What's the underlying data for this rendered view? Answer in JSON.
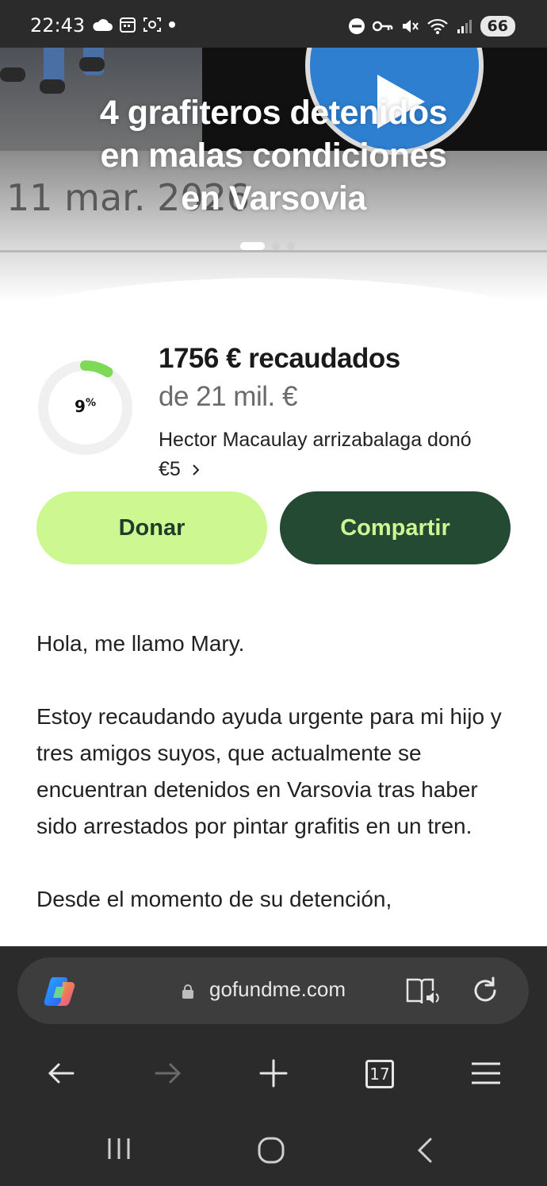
{
  "status_bar": {
    "time": "22:43",
    "battery": "66",
    "left_icons": [
      "cloud-icon",
      "calendar-icon",
      "screenshot-icon",
      "dot-icon"
    ],
    "right_icons": [
      "do-not-disturb-icon",
      "key-icon",
      "mute-icon",
      "wifi-icon",
      "signal-icon"
    ]
  },
  "hero": {
    "title_line1": "4 grafiteros detenidos",
    "title_line2": "en malas condiciones",
    "title_line3": "en Varsovia",
    "background_date": "11 mar. 2026",
    "slides_total": 3,
    "slide_active": 1
  },
  "campaign": {
    "progress_percent": "9",
    "progress_symbol": "%",
    "progress_fraction": 0.09,
    "raised": "1756 € recaudados",
    "goal": "de 21 mil. €",
    "recent_donation_line1": "Hector Macaulay arrizabalaga donó",
    "recent_donation_line2": "€5",
    "colors": {
      "ring_fill": "#7ed957",
      "ring_track": "#f0f0f0"
    }
  },
  "buttons": {
    "donate": "Donar",
    "share": "Compartir"
  },
  "story": {
    "p1": "Hola, me llamo Mary.",
    "p2": "Estoy recaudando ayuda urgente para mi hijo y tres amigos suyos, que actualmente se encuentran detenidos en Varsovia tras haber sido arrestados por pintar grafitis en un tren.",
    "p3": "Desde el momento de su detención,"
  },
  "browser": {
    "url": "gofundme.com",
    "tabs_count": "17",
    "icons": [
      "copilot-icon",
      "lock-icon",
      "reader-mode-icon",
      "reload-icon",
      "back-arrow-icon",
      "forward-arrow-icon",
      "new-tab-icon",
      "tabs-icon",
      "menu-icon"
    ]
  },
  "system_nav": {
    "icons": [
      "recents-icon",
      "home-icon",
      "back-icon"
    ]
  },
  "colors": {
    "donate_bg": "#cdf790",
    "donate_text": "#1f3d2b",
    "share_bg": "#244a33",
    "share_text": "#cdf790",
    "browser_bg": "#2b2b2b"
  }
}
